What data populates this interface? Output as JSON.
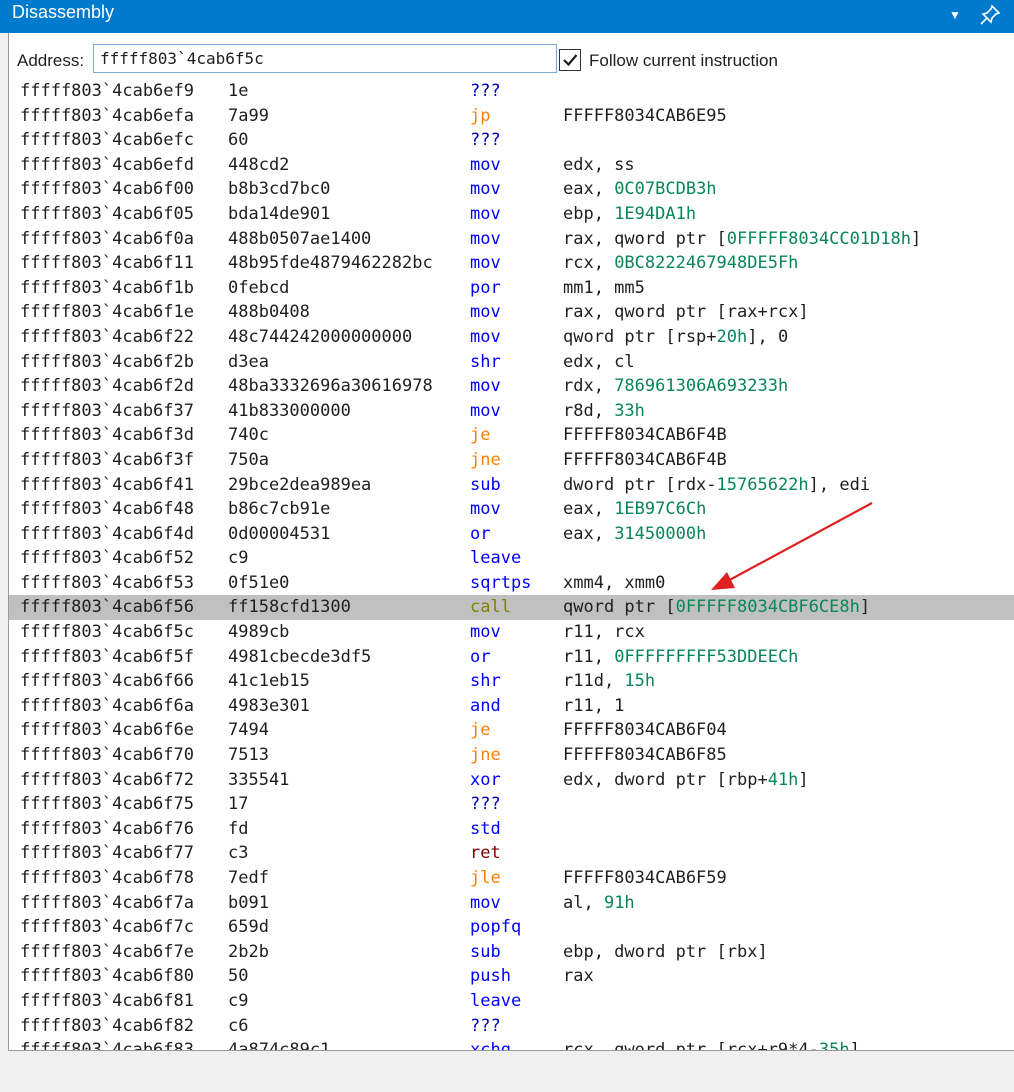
{
  "window": {
    "title": "Disassembly",
    "dropdown_icon": "chevron-down-icon",
    "pin_icon": "pin-icon"
  },
  "toolbar": {
    "address_label": "Address:",
    "address_value": "fffff803`4cab6f5c",
    "follow_checked": true,
    "follow_label": "Follow current instruction"
  },
  "colors": {
    "titlebar": "#007acc",
    "mnemonic_default": "#0000ff",
    "mnemonic_jump": "#ff8000",
    "mnemonic_call": "#808000",
    "mnemonic_ret": "#800000",
    "numeric_literal": "#098658",
    "selection": "#c0c0c0",
    "annotation_arrow": "#e02020"
  },
  "selected_index": 21,
  "rows": [
    {
      "addr": "fffff803`4cab6ef9",
      "bytes": "1e",
      "mn": "???",
      "op": []
    },
    {
      "addr": "fffff803`4cab6efa",
      "bytes": "7a99",
      "mn": "jp",
      "op": [
        [
          "FFFFF8034CAB6E95",
          ""
        ]
      ]
    },
    {
      "addr": "fffff803`4cab6efc",
      "bytes": "60",
      "mn": "???",
      "op": []
    },
    {
      "addr": "fffff803`4cab6efd",
      "bytes": "448cd2",
      "mn": "mov",
      "op": [
        [
          "edx, ss",
          ""
        ]
      ]
    },
    {
      "addr": "fffff803`4cab6f00",
      "bytes": "b8b3cd7bc0",
      "mn": "mov",
      "op": [
        [
          "eax, ",
          ""
        ],
        [
          "0C07BCDB3h",
          "n"
        ]
      ]
    },
    {
      "addr": "fffff803`4cab6f05",
      "bytes": "bda14de901",
      "mn": "mov",
      "op": [
        [
          "ebp, ",
          ""
        ],
        [
          "1E94DA1h",
          "n"
        ]
      ]
    },
    {
      "addr": "fffff803`4cab6f0a",
      "bytes": "488b0507ae1400",
      "mn": "mov",
      "op": [
        [
          "rax, qword ptr [",
          ""
        ],
        [
          "0FFFFF8034CC01D18h",
          "n"
        ],
        [
          "]",
          ""
        ]
      ]
    },
    {
      "addr": "fffff803`4cab6f11",
      "bytes": "48b95fde4879462282bc",
      "mn": "mov",
      "op": [
        [
          "rcx, ",
          ""
        ],
        [
          "0BC8222467948DE5Fh",
          "n"
        ]
      ]
    },
    {
      "addr": "fffff803`4cab6f1b",
      "bytes": "0febcd",
      "mn": "por",
      "op": [
        [
          "mm1, mm5",
          ""
        ]
      ]
    },
    {
      "addr": "fffff803`4cab6f1e",
      "bytes": "488b0408",
      "mn": "mov",
      "op": [
        [
          "rax, qword ptr [rax+rcx]",
          ""
        ]
      ]
    },
    {
      "addr": "fffff803`4cab6f22",
      "bytes": "48c744242000000000",
      "mn": "mov",
      "op": [
        [
          "qword ptr [rsp+",
          ""
        ],
        [
          "20h",
          "n"
        ],
        [
          "], 0",
          ""
        ]
      ]
    },
    {
      "addr": "fffff803`4cab6f2b",
      "bytes": "d3ea",
      "mn": "shr",
      "op": [
        [
          "edx, cl",
          ""
        ]
      ]
    },
    {
      "addr": "fffff803`4cab6f2d",
      "bytes": "48ba3332696a30616978",
      "mn": "mov",
      "op": [
        [
          "rdx, ",
          ""
        ],
        [
          "786961306A693233h",
          "n"
        ]
      ]
    },
    {
      "addr": "fffff803`4cab6f37",
      "bytes": "41b833000000",
      "mn": "mov",
      "op": [
        [
          "r8d, ",
          ""
        ],
        [
          "33h",
          "n"
        ]
      ]
    },
    {
      "addr": "fffff803`4cab6f3d",
      "bytes": "740c",
      "mn": "je",
      "op": [
        [
          "FFFFF8034CAB6F4B",
          ""
        ]
      ]
    },
    {
      "addr": "fffff803`4cab6f3f",
      "bytes": "750a",
      "mn": "jne",
      "op": [
        [
          "FFFFF8034CAB6F4B",
          ""
        ]
      ]
    },
    {
      "addr": "fffff803`4cab6f41",
      "bytes": "29bce2dea989ea",
      "mn": "sub",
      "op": [
        [
          "dword ptr [rdx-",
          ""
        ],
        [
          "15765622h",
          "n"
        ],
        [
          "], edi",
          ""
        ]
      ]
    },
    {
      "addr": "fffff803`4cab6f48",
      "bytes": "b86c7cb91e",
      "mn": "mov",
      "op": [
        [
          "eax, ",
          ""
        ],
        [
          "1EB97C6Ch",
          "n"
        ]
      ]
    },
    {
      "addr": "fffff803`4cab6f4d",
      "bytes": "0d00004531",
      "mn": "or",
      "op": [
        [
          "eax, ",
          ""
        ],
        [
          "31450000h",
          "n"
        ]
      ]
    },
    {
      "addr": "fffff803`4cab6f52",
      "bytes": "c9",
      "mn": "leave",
      "op": []
    },
    {
      "addr": "fffff803`4cab6f53",
      "bytes": "0f51e0",
      "mn": "sqrtps",
      "op": [
        [
          "xmm4, xmm0",
          ""
        ]
      ]
    },
    {
      "addr": "fffff803`4cab6f56",
      "bytes": "ff158cfd1300",
      "mn": "call",
      "op": [
        [
          "qword ptr [",
          ""
        ],
        [
          "0FFFFF8034CBF6CE8h",
          "n"
        ],
        [
          "]",
          ""
        ]
      ]
    },
    {
      "addr": "fffff803`4cab6f5c",
      "bytes": "4989cb",
      "mn": "mov",
      "op": [
        [
          "r11, rcx",
          ""
        ]
      ]
    },
    {
      "addr": "fffff803`4cab6f5f",
      "bytes": "4981cbecde3df5",
      "mn": "or",
      "op": [
        [
          "r11, ",
          ""
        ],
        [
          "0FFFFFFFFF53DDEECh",
          "n"
        ]
      ]
    },
    {
      "addr": "fffff803`4cab6f66",
      "bytes": "41c1eb15",
      "mn": "shr",
      "op": [
        [
          "r11d, ",
          ""
        ],
        [
          "15h",
          "n"
        ]
      ]
    },
    {
      "addr": "fffff803`4cab6f6a",
      "bytes": "4983e301",
      "mn": "and",
      "op": [
        [
          "r11, 1",
          ""
        ]
      ]
    },
    {
      "addr": "fffff803`4cab6f6e",
      "bytes": "7494",
      "mn": "je",
      "op": [
        [
          "FFFFF8034CAB6F04",
          ""
        ]
      ]
    },
    {
      "addr": "fffff803`4cab6f70",
      "bytes": "7513",
      "mn": "jne",
      "op": [
        [
          "FFFFF8034CAB6F85",
          ""
        ]
      ]
    },
    {
      "addr": "fffff803`4cab6f72",
      "bytes": "335541",
      "mn": "xor",
      "op": [
        [
          "edx, dword ptr [rbp+",
          ""
        ],
        [
          "41h",
          "n"
        ],
        [
          "]",
          ""
        ]
      ]
    },
    {
      "addr": "fffff803`4cab6f75",
      "bytes": "17",
      "mn": "???",
      "op": []
    },
    {
      "addr": "fffff803`4cab6f76",
      "bytes": "fd",
      "mn": "std",
      "op": []
    },
    {
      "addr": "fffff803`4cab6f77",
      "bytes": "c3",
      "mn": "ret",
      "op": []
    },
    {
      "addr": "fffff803`4cab6f78",
      "bytes": "7edf",
      "mn": "jle",
      "op": [
        [
          "FFFFF8034CAB6F59",
          ""
        ]
      ]
    },
    {
      "addr": "fffff803`4cab6f7a",
      "bytes": "b091",
      "mn": "mov",
      "op": [
        [
          "al, ",
          ""
        ],
        [
          "91h",
          "n"
        ]
      ]
    },
    {
      "addr": "fffff803`4cab6f7c",
      "bytes": "659d",
      "mn": "popfq",
      "op": []
    },
    {
      "addr": "fffff803`4cab6f7e",
      "bytes": "2b2b",
      "mn": "sub",
      "op": [
        [
          "ebp, dword ptr [rbx]",
          ""
        ]
      ]
    },
    {
      "addr": "fffff803`4cab6f80",
      "bytes": "50",
      "mn": "push",
      "op": [
        [
          "rax",
          ""
        ]
      ]
    },
    {
      "addr": "fffff803`4cab6f81",
      "bytes": "c9",
      "mn": "leave",
      "op": []
    },
    {
      "addr": "fffff803`4cab6f82",
      "bytes": "c6",
      "mn": "???",
      "op": []
    },
    {
      "addr": "fffff803`4cab6f83",
      "bytes": "4a874c89c1",
      "mn": "xchg",
      "op": [
        [
          "rcx, qword ptr [rcx+r9*4-",
          ""
        ],
        [
          "35h",
          "n"
        ],
        [
          "]",
          ""
        ]
      ]
    }
  ]
}
